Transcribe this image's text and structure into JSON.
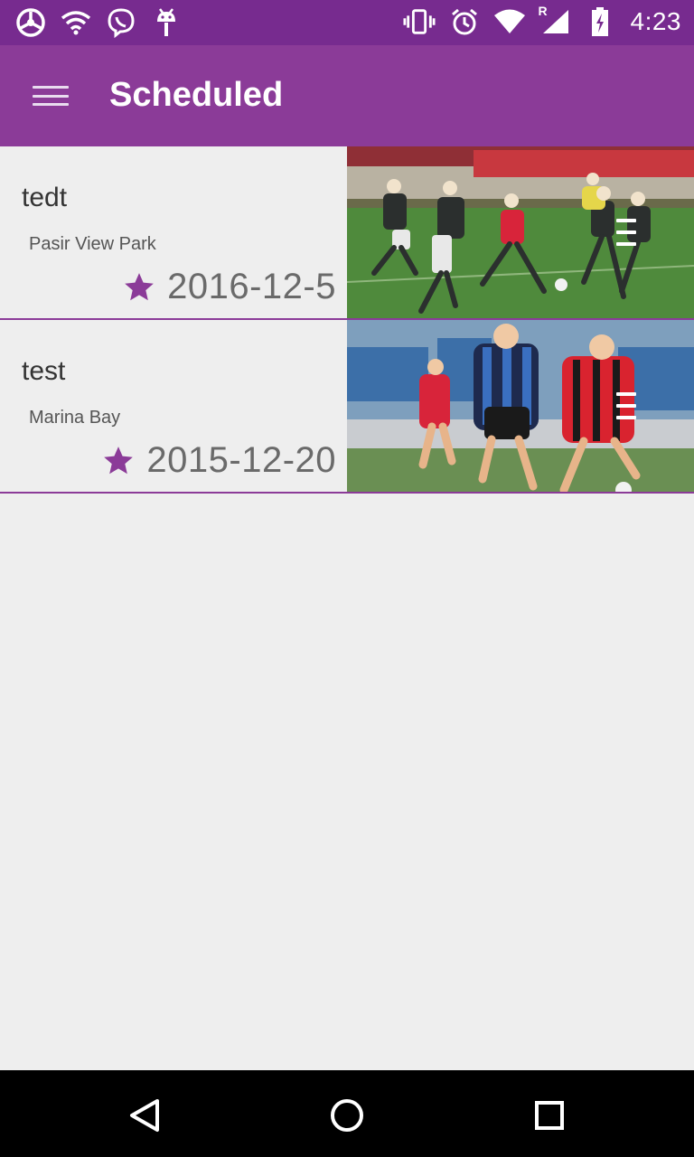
{
  "status_bar": {
    "time": "4:23",
    "left_icons": [
      "steering-wheel-icon",
      "wifi-icon",
      "viber-icon",
      "android-debug-icon"
    ],
    "right_icons": [
      "vibrate-icon",
      "alarm-icon",
      "wifi-signal-icon",
      "cell-signal-roaming-icon",
      "battery-charging-icon"
    ],
    "roaming_label": "R"
  },
  "app_bar": {
    "title": "Scheduled",
    "background": "#8b3b98",
    "status_background": "#772b8f"
  },
  "events": [
    {
      "title": "tedt",
      "location": "Pasir View Park",
      "date": "2016-12-5",
      "thumbnail": "soccer-match-photo"
    },
    {
      "title": "test",
      "location": "Marina Bay",
      "date": "2015-12-20",
      "thumbnail": "soccer-match-photo"
    }
  ],
  "nav_bar": {
    "buttons": [
      "back-icon",
      "home-icon",
      "recents-icon"
    ]
  },
  "colors": {
    "accent": "#8b3b98",
    "page_background": "#eeeeee"
  }
}
